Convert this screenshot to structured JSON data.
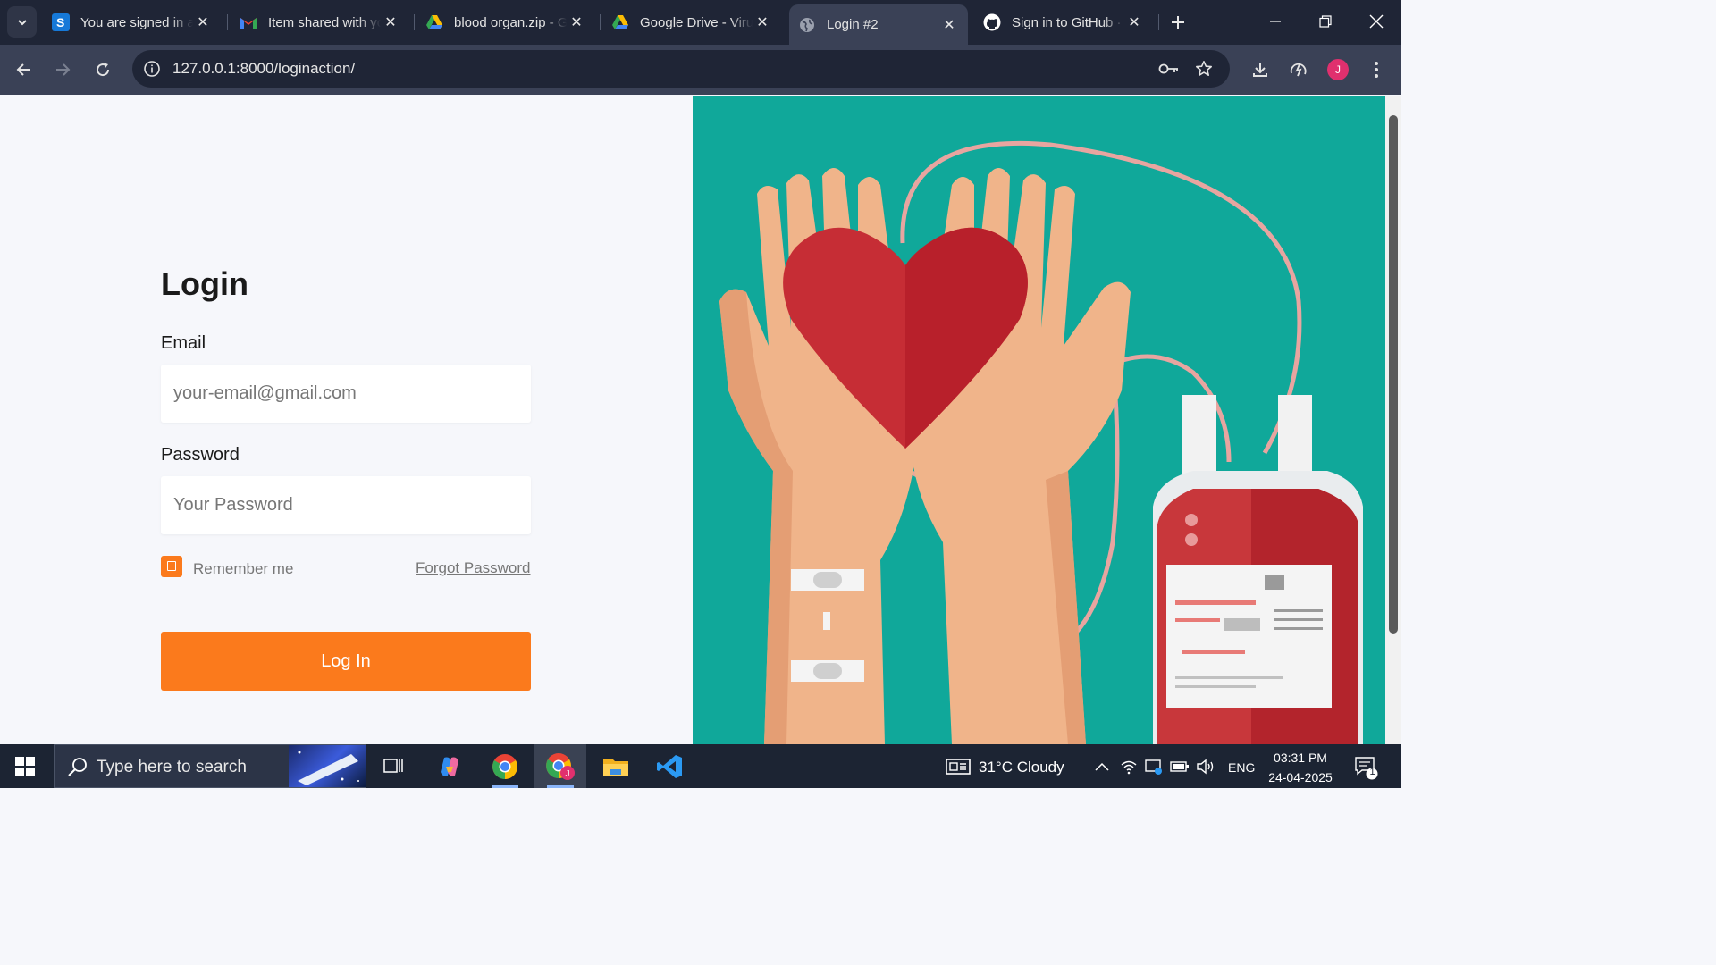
{
  "browser": {
    "tabs": [
      {
        "title": "You are signed in as",
        "icon": "simplilearn-s-icon",
        "active": false
      },
      {
        "title": "Item shared with you",
        "icon": "gmail-icon",
        "active": false
      },
      {
        "title": "blood organ.zip - Google Drive",
        "icon": "google-drive-icon",
        "active": false
      },
      {
        "title": "Google Drive - Virus scan warning",
        "icon": "google-drive-icon",
        "active": false
      },
      {
        "title": "Login #2",
        "icon": "globe-icon",
        "active": true
      },
      {
        "title": "Sign in to GitHub · GitHub",
        "icon": "github-icon",
        "active": false
      }
    ],
    "url": "127.0.0.1:8000/loginaction/",
    "profile_initial": "J"
  },
  "login": {
    "title": "Login",
    "email_label": "Email",
    "email_placeholder": "your-email@gmail.com",
    "password_label": "Password",
    "password_placeholder": "Your Password",
    "remember_label": "Remember me",
    "forgot_label": "Forgot Password",
    "submit_label": "Log In"
  },
  "illustration": {
    "description_icon": "blood-donation-illustration-icon"
  },
  "taskbar": {
    "search_placeholder": "Type here to search",
    "weather": "31°C  Cloudy",
    "language": "ENG",
    "time": "03:31 PM",
    "date": "24-04-2025",
    "notification_count": "1"
  },
  "colors": {
    "accent": "#fb7a1c",
    "illustration_bg": "#10a89a",
    "page_bg": "#f6f7fb",
    "chrome_dark": "#1f2536",
    "chrome_toolbar": "#3a4156"
  }
}
